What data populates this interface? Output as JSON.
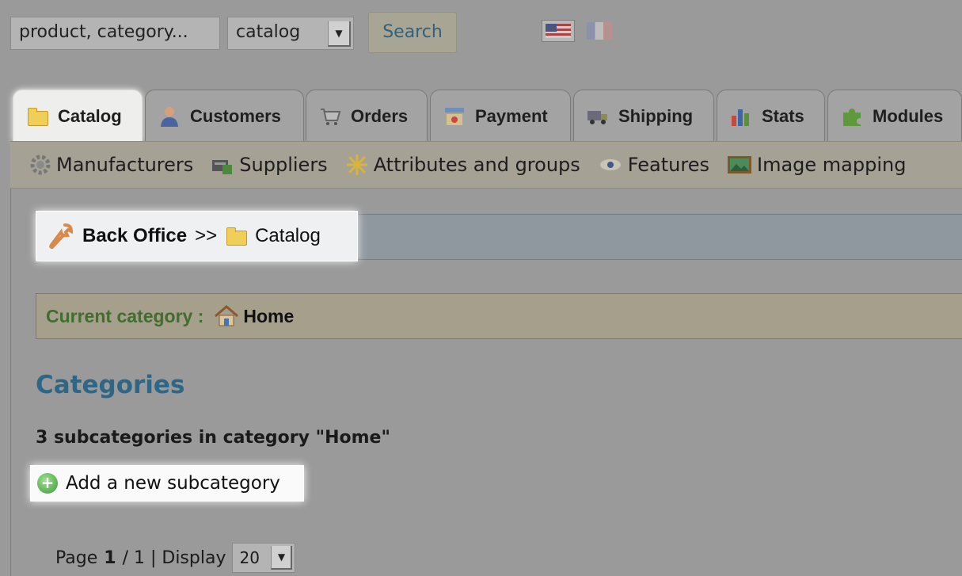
{
  "search": {
    "input_value": "product, category...",
    "select_value": "catalog",
    "button_label": "Search"
  },
  "languages": [
    "us-flag-icon",
    "fr-flag-icon"
  ],
  "tabs": [
    {
      "label": "Catalog",
      "icon": "folder-icon",
      "active": true
    },
    {
      "label": "Customers",
      "icon": "customer-icon",
      "active": false
    },
    {
      "label": "Orders",
      "icon": "cart-icon",
      "active": false
    },
    {
      "label": "Payment",
      "icon": "payment-icon",
      "active": false
    },
    {
      "label": "Shipping",
      "icon": "truck-icon",
      "active": false
    },
    {
      "label": "Stats",
      "icon": "bar-chart-icon",
      "active": false
    },
    {
      "label": "Modules",
      "icon": "puzzle-icon",
      "active": false
    }
  ],
  "subnav": [
    {
      "label": "Manufacturers",
      "icon": "gear-icon"
    },
    {
      "label": "Suppliers",
      "icon": "supplier-icon"
    },
    {
      "label": "Attributes and groups",
      "icon": "attributes-icon"
    },
    {
      "label": "Features",
      "icon": "eye-icon"
    },
    {
      "label": "Image mapping",
      "icon": "image-icon"
    }
  ],
  "breadcrumb": {
    "root": "Back Office",
    "separator": ">>",
    "current": "Catalog"
  },
  "current_category": {
    "label": "Current category :",
    "value": "Home"
  },
  "section_title": "Categories",
  "subcategory_count_text": "3 subcategories in category \"Home\"",
  "add_subcategory_label": "Add a new subcategory",
  "pagination": {
    "page_label": "Page",
    "current_page": "1",
    "total_text": "/ 1 | Display",
    "display_value": "20"
  },
  "colors": {
    "title_blue": "#2e6688",
    "current_category_green": "#3f6e2e"
  }
}
